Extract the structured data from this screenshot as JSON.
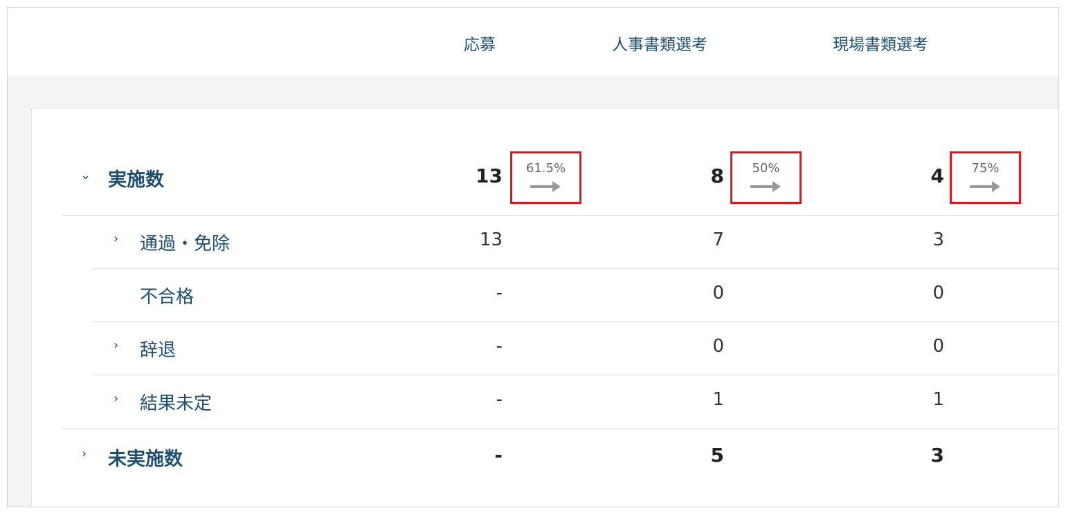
{
  "header": {
    "columns": [
      "応募",
      "人事書類選考",
      "現場書類選考"
    ]
  },
  "rows": {
    "implemented": {
      "label": "実施数",
      "values": [
        "13",
        "8",
        "4"
      ],
      "rates": [
        "61.5%",
        "50%",
        "75%"
      ]
    },
    "passed": {
      "label": "通過・免除",
      "values": [
        "13",
        "7",
        "3"
      ]
    },
    "failed": {
      "label": "不合格",
      "values": [
        "-",
        "0",
        "0"
      ]
    },
    "declined": {
      "label": "辞退",
      "values": [
        "-",
        "0",
        "0"
      ]
    },
    "pending": {
      "label": "結果未定",
      "values": [
        "-",
        "1",
        "1"
      ]
    },
    "not_implemented": {
      "label": "未実施数",
      "values": [
        "-",
        "5",
        "3"
      ]
    }
  },
  "icons": {
    "expanded": "chevron-down-icon",
    "collapsed": "chevron-right-icon",
    "rate_arrow": "arrow-right-icon"
  },
  "colors": {
    "label": "#1f4e6e",
    "highlight_border": "#e8141a",
    "arrow": "#999999"
  }
}
